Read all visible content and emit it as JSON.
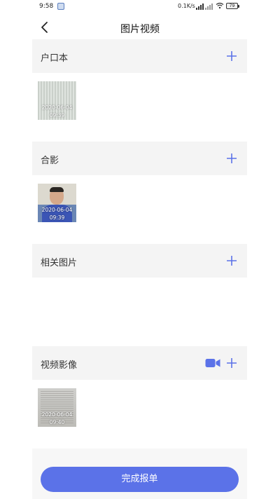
{
  "status_bar": {
    "time": "9:58",
    "network_speed": "0.1K/s",
    "battery": "79"
  },
  "header": {
    "title": "图片视频"
  },
  "sections": [
    {
      "title": "户口本",
      "items": [
        {
          "date": "2020-06-04",
          "time": "09:39"
        }
      ]
    },
    {
      "title": "合影",
      "items": [
        {
          "date": "2020-06-04",
          "time": "09:39"
        }
      ]
    },
    {
      "title": "相关图片",
      "items": []
    },
    {
      "title": "视频影像",
      "items": [
        {
          "date": "2020-06-04",
          "time": "09:40"
        }
      ]
    }
  ],
  "footer": {
    "submit_label": "完成报单"
  },
  "colors": {
    "accent": "#5b72e8",
    "icon_blue": "#5b72e8"
  }
}
